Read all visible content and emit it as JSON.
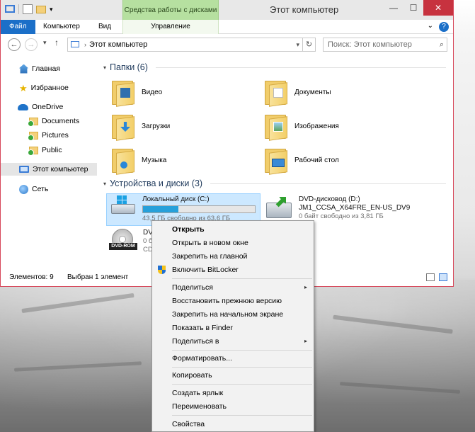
{
  "window": {
    "title": "Этот компьютер",
    "contextual_tab_group": "Средства работы с дисками",
    "ribbon_tabs": [
      "Файл",
      "Компьютер",
      "Вид",
      "Управление"
    ],
    "help": "?",
    "min": "—",
    "max": "☐",
    "close": "✕",
    "collapse": "⌄"
  },
  "address": {
    "back": "←",
    "forward": "→",
    "up": "↑",
    "recent": "▾",
    "path": "Этот компьютер",
    "dropdown": "▾",
    "refresh": "↻",
    "search_placeholder": "Поиск: Этот компьютер",
    "search_icon": "⌕"
  },
  "nav_pane": {
    "items": [
      {
        "label": "Главная",
        "icon": "home-icon"
      },
      {
        "label": "Избранное",
        "icon": "star-icon"
      },
      {
        "label": "OneDrive",
        "icon": "cloud-icon"
      },
      {
        "label": "Documents",
        "icon": "synced-folder-icon"
      },
      {
        "label": "Pictures",
        "icon": "synced-folder-icon"
      },
      {
        "label": "Public",
        "icon": "synced-folder-icon"
      },
      {
        "label": "Этот компьютер",
        "icon": "computer-icon",
        "selected": true
      },
      {
        "label": "Сеть",
        "icon": "network-icon"
      }
    ]
  },
  "folders_group": {
    "header": "Папки (6)",
    "folders": [
      {
        "label": "Видео",
        "icon": "video-folder-icon"
      },
      {
        "label": "Документы",
        "icon": "documents-folder-icon"
      },
      {
        "label": "Загрузки",
        "icon": "downloads-folder-icon"
      },
      {
        "label": "Изображения",
        "icon": "pictures-folder-icon"
      },
      {
        "label": "Музыка",
        "icon": "music-folder-icon"
      },
      {
        "label": "Рабочий стол",
        "icon": "desktop-folder-icon"
      }
    ]
  },
  "devices_group": {
    "header": "Устройства и диски (3)",
    "local_disk": {
      "name": "Локальный диск (C:)",
      "free": "43,5 ГБ свободно из 63,6 ГБ",
      "used_fraction": 0.316
    },
    "dvd_drive": {
      "name": "DVD-дисковод (D:)",
      "label": "JM1_CCSA_X64FRE_EN-US_DV9",
      "free": "0 байт свободно из 3,81 ГБ"
    },
    "dvd_rom": {
      "name_partial": "DV",
      "line2_partial": "0 б",
      "line3_partial": "CD",
      "badge": "DVD-ROM"
    }
  },
  "status": {
    "count": "Элементов: 9",
    "selected": "Выбран 1 элемент"
  },
  "context_menu": {
    "items": [
      {
        "label": "Открыть",
        "bold": true
      },
      {
        "label": "Открыть в новом окне"
      },
      {
        "label": "Закрепить на главной"
      },
      {
        "label": "Включить BitLocker",
        "icon": "uac-shield-icon"
      },
      {
        "label": "Поделиться",
        "submenu": true
      },
      {
        "label": "Восстановить прежнюю версию"
      },
      {
        "label": "Закрепить на начальном экране"
      },
      {
        "label": "Показать в Finder"
      },
      {
        "label": "Поделиться в",
        "submenu": true
      },
      {
        "label": "Форматировать..."
      },
      {
        "label": "Копировать"
      },
      {
        "label": "Создать ярлык"
      },
      {
        "label": "Переименовать"
      },
      {
        "label": "Свойства"
      }
    ],
    "submenu_arrow": "▸"
  }
}
